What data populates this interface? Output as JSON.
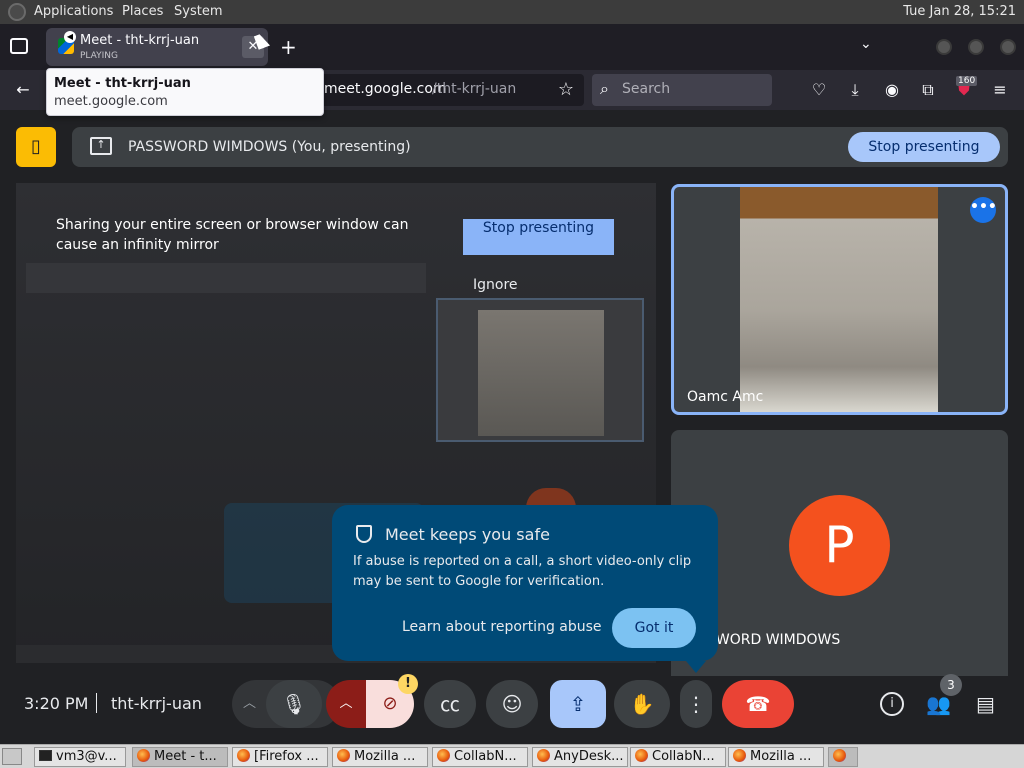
{
  "panel": {
    "menus": [
      "Applications",
      "Places",
      "System"
    ],
    "clock": "Tue Jan 28, 15:21"
  },
  "browser": {
    "tab": {
      "title": "Meet - tht-krrj-uan",
      "subtitle": "PLAYING"
    },
    "tooltip": {
      "title": "Meet - tht-krrj-uan",
      "url": "meet.google.com"
    },
    "url": {
      "host": "meet.google.com",
      "path": "/tht-krrj-uan"
    },
    "search_placeholder": "Search",
    "extension_badge": "160"
  },
  "meet": {
    "banner_text": "PASSWORD WIMDOWS (You, presenting)",
    "stop_presenting": "Stop presenting",
    "warning": {
      "text": "Sharing your entire screen or browser window can cause an infinity mirror",
      "stop_button": "Stop presenting",
      "ignore": "Ignore"
    },
    "participants": [
      {
        "name": "Oamc Amc"
      },
      {
        "name": "PASSWORD WIMDOWS",
        "initial": "P",
        "visible_name": "SWORD WIMDOWS",
        "color": "#f4511e"
      }
    ],
    "safe_popup": {
      "title": "Meet keeps you safe",
      "body": "If abuse is reported on a call, a short video-only clip may be sent to Google for verification.",
      "learn": "Learn about reporting abuse",
      "got_it": "Got it"
    },
    "controls": {
      "time": "3:20 PM",
      "meeting_code": "tht-krrj-uan",
      "people_count": "3"
    }
  },
  "taskbar": {
    "items": [
      "vm3@v...",
      "Meet - t...",
      "[Firefox ...",
      "Mozilla ...",
      "CollabN...",
      "AnyDesk...",
      "CollabN...",
      "Mozilla ..."
    ]
  },
  "colors": {
    "accent": "#a8c7fa",
    "end_call": "#ea4335",
    "active_border": "#8ab4f8",
    "popup_bg": "#004a77"
  }
}
